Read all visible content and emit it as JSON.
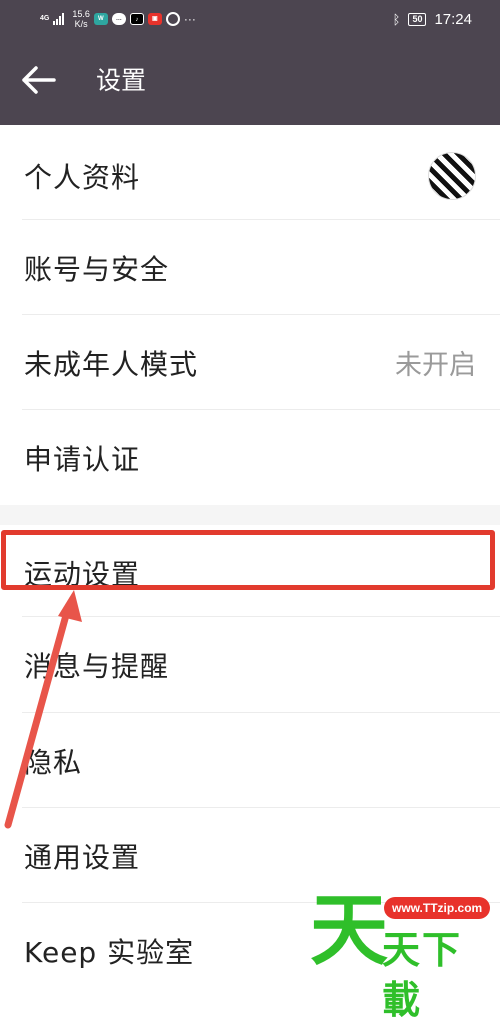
{
  "status_bar": {
    "network_type": "4G",
    "signal_bars": 4,
    "speed_value": "15.6",
    "speed_unit": "K/s",
    "app_icons": [
      "wps-icon",
      "chat-icon",
      "tiktok-icon",
      "red-app-icon",
      "loading-icon",
      "more-dots-icon"
    ],
    "bluetooth": "bluetooth-icon",
    "battery": "50",
    "time": "17:24"
  },
  "header": {
    "back_icon": "back-arrow-icon",
    "title": "设置"
  },
  "settings": {
    "items": [
      {
        "label": "个人资料",
        "value": "",
        "icon": "avatar"
      },
      {
        "label": "账号与安全",
        "value": ""
      },
      {
        "label": "未成年人模式",
        "value": "未开启"
      },
      {
        "label": "申请认证",
        "value": ""
      },
      {
        "label": "运动设置",
        "value": "",
        "highlighted": true
      },
      {
        "label": "消息与提醒",
        "value": ""
      },
      {
        "label": "隐私",
        "value": ""
      },
      {
        "label": "通用设置",
        "value": ""
      },
      {
        "label": "Keep 实验室",
        "value": ""
      }
    ]
  },
  "annotation": {
    "highlight_color": "#e23b2e",
    "arrow_color": "#e8554a"
  },
  "watermark": {
    "big_char": "天",
    "url": "www.TTzip.com",
    "text": "天下載"
  },
  "colors": {
    "header_bg": "#4c4550",
    "text": "#222222",
    "secondary_text": "#9a9a9a"
  }
}
